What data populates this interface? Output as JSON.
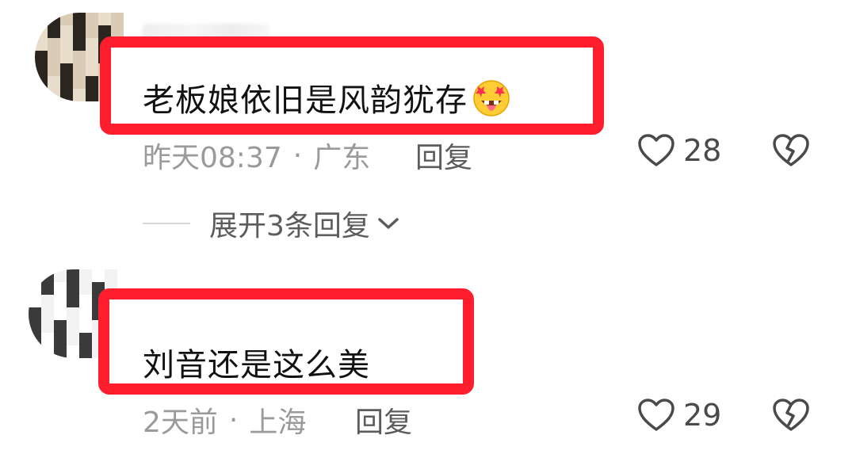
{
  "comments": [
    {
      "text": "老板娘依旧是风韵犹存",
      "emoji": "star-struck-tongue-emoji",
      "time": "昨天08:37",
      "separator": "·",
      "location": "广东",
      "reply_label": "回复",
      "likes": "28",
      "expand_label": "展开3条回复"
    },
    {
      "text": "刘音还是这么美",
      "time": "2天前",
      "separator": "·",
      "location": "上海",
      "reply_label": "回复",
      "likes": "29"
    }
  ],
  "colors": {
    "highlight": "#ff1e2d",
    "meta": "#9a9a9a",
    "text": "#111111"
  },
  "icons": {
    "like": "heart-outline-icon",
    "dislike": "broken-heart-icon",
    "expand": "chevron-down-icon"
  }
}
